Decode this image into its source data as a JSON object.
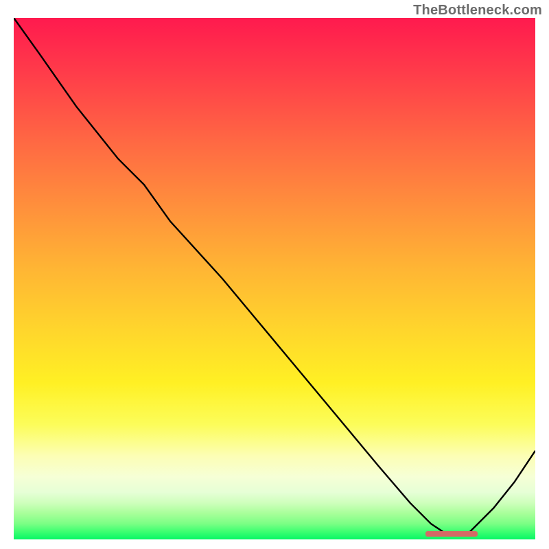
{
  "watermark": "TheBottleneck.com",
  "colors": {
    "gradient_top": "#ff1a4e",
    "gradient_mid": "#ffd62c",
    "gradient_bottom": "#07f765",
    "curve": "#000000",
    "marker": "#d46a65",
    "watermark_text": "#6b6b6b"
  },
  "chart_data": {
    "type": "line",
    "title": "",
    "xlabel": "",
    "ylabel": "",
    "xlim": [
      0,
      100
    ],
    "ylim": [
      0,
      100
    ],
    "grid": false,
    "legend": false,
    "note": "x is a normalized performance axis (0=left, 100=right); y is a bottleneck/mismatch score (0 at bottom green band = optimal, 100 at top red = worst). Values estimated from pixel positions.",
    "series": [
      {
        "name": "bottleneck-curve",
        "x": [
          0,
          5,
          12,
          20,
          25,
          30,
          40,
          50,
          60,
          70,
          76,
          80,
          83,
          87,
          92,
          96,
          100
        ],
        "y": [
          100,
          93,
          83,
          73,
          68,
          61,
          50,
          38,
          26,
          14,
          7,
          3,
          1,
          1,
          6,
          11,
          17
        ]
      }
    ],
    "marker": {
      "name": "optimal-range",
      "x_start": 79,
      "x_end": 89,
      "y": 1
    }
  }
}
